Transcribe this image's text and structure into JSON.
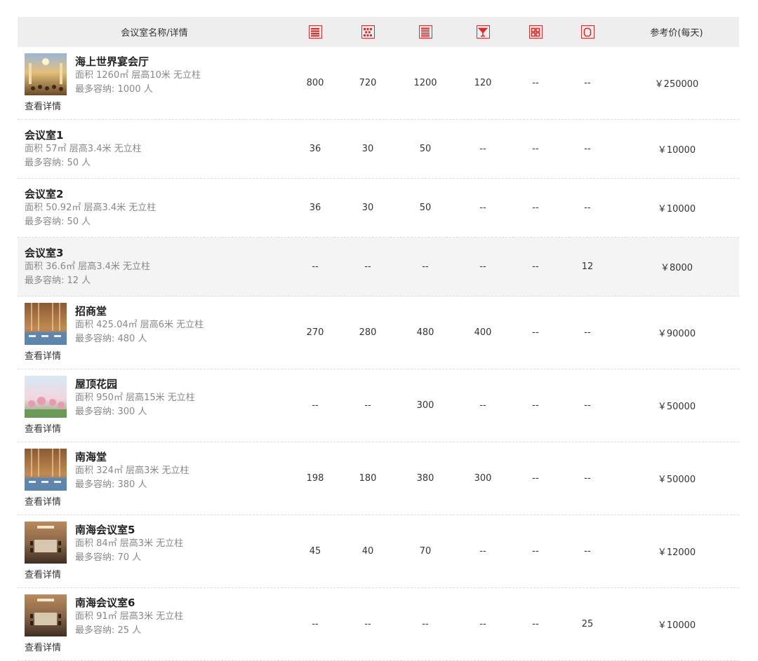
{
  "header": {
    "name_label": "会议室名称/详情",
    "price_label": "参考价(每天)",
    "layout_icons": [
      "theater-layout-icon",
      "round-table-layout-icon",
      "classroom-layout-icon",
      "cocktail-layout-icon",
      "boardroom-layout-icon",
      "u-shape-layout-icon"
    ]
  },
  "details_label": "查看详情",
  "accent_color": "#d72d2d",
  "rooms": [
    {
      "name": "海上世界宴会厅",
      "area": "面积 1260㎡ 层高10米 无立柱",
      "capacity": "最多容纳: 1000 人",
      "photo": "banquet-hall-photo",
      "values": [
        "800",
        "720",
        "1200",
        "120",
        "--",
        "--"
      ],
      "price": "￥250000"
    },
    {
      "name": "会议室1",
      "area": "面积 57㎡ 层高3.4米 无立柱",
      "capacity": "最多容纳: 50 人",
      "values": [
        "36",
        "30",
        "50",
        "--",
        "--",
        "--"
      ],
      "price": "￥10000"
    },
    {
      "name": "会议室2",
      "area": "面积 50.92㎡ 层高3.4米 无立柱",
      "capacity": "最多容纳: 50 人",
      "values": [
        "36",
        "30",
        "50",
        "--",
        "--",
        "--"
      ],
      "price": "￥10000"
    },
    {
      "name": "会议室3",
      "area": "面积 36.6㎡ 层高3.4米 无立柱",
      "capacity": "最多容纳: 12 人",
      "values": [
        "--",
        "--",
        "--",
        "--",
        "--",
        "12"
      ],
      "price": "￥8000",
      "highlight": true
    },
    {
      "name": "招商堂",
      "area": "面积 425.04㎡ 层高6米 无立柱",
      "capacity": "最多容纳: 480 人",
      "photo": "hall-photo",
      "values": [
        "270",
        "280",
        "480",
        "400",
        "--",
        "--"
      ],
      "price": "￥90000"
    },
    {
      "name": "屋顶花园",
      "area": "面积 950㎡ 层高15米 无立柱",
      "capacity": "最多容纳: 300 人",
      "photo": "garden-photo",
      "values": [
        "--",
        "--",
        "300",
        "--",
        "--",
        "--"
      ],
      "price": "￥50000"
    },
    {
      "name": "南海堂",
      "area": "面积 324㎡ 层高3米 无立柱",
      "capacity": "最多容纳: 380 人",
      "photo": "hall-photo",
      "values": [
        "198",
        "180",
        "380",
        "300",
        "--",
        "--"
      ],
      "price": "￥50000"
    },
    {
      "name": "南海会议室5",
      "area": "面积 84㎡ 层高3米 无立柱",
      "capacity": "最多容纳: 70 人",
      "photo": "meeting-room-photo",
      "values": [
        "45",
        "40",
        "70",
        "--",
        "--",
        "--"
      ],
      "price": "￥12000"
    },
    {
      "name": "南海会议室6",
      "area": "面积 91㎡ 层高3米 无立柱",
      "capacity": "最多容纳: 25 人",
      "photo": "meeting-room-photo",
      "values": [
        "--",
        "--",
        "--",
        "--",
        "--",
        "25"
      ],
      "price": "￥10000"
    }
  ]
}
